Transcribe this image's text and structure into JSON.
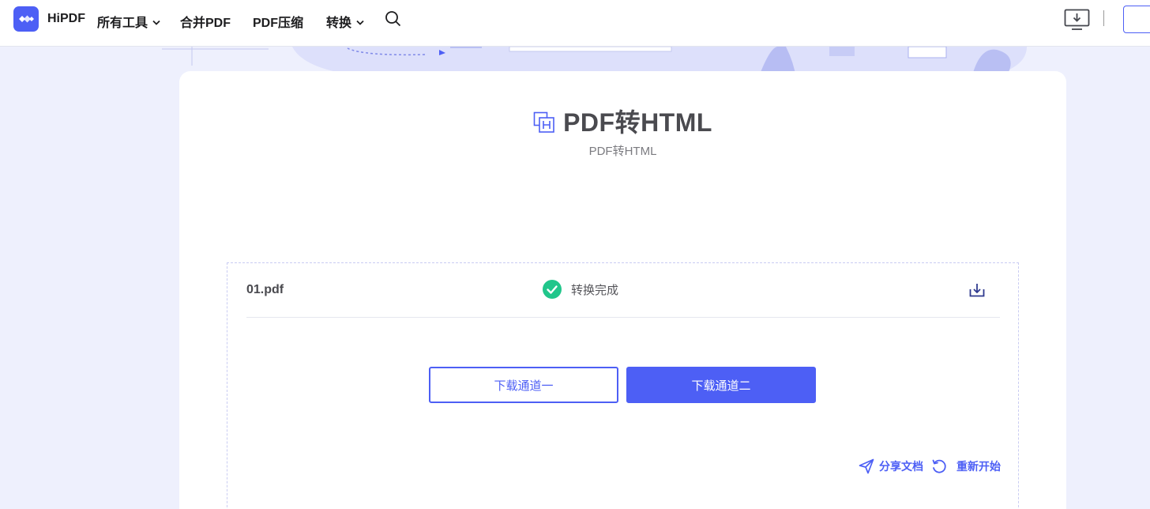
{
  "brand": {
    "name": "HiPDF",
    "accent": "#4d5ff5"
  },
  "nav": {
    "items": [
      {
        "label": "所有工具",
        "has_dropdown": true
      },
      {
        "label": "合并PDF",
        "has_dropdown": false
      },
      {
        "label": "PDF压缩",
        "has_dropdown": false
      },
      {
        "label": "转换",
        "has_dropdown": true
      }
    ],
    "icons": [
      "search-icon",
      "desktop-download-icon"
    ]
  },
  "tool": {
    "title": "PDF转HTML",
    "subtitle": "PDF转HTML",
    "icon": "html-file-icon"
  },
  "result": {
    "file_name": "01.pdf",
    "status": "转换完成",
    "status_color": "#21c68b"
  },
  "buttons": {
    "channel_one": "下载通道一",
    "channel_two": "下载通道二"
  },
  "actions": {
    "share": "分享文档",
    "restart": "重新开始"
  }
}
